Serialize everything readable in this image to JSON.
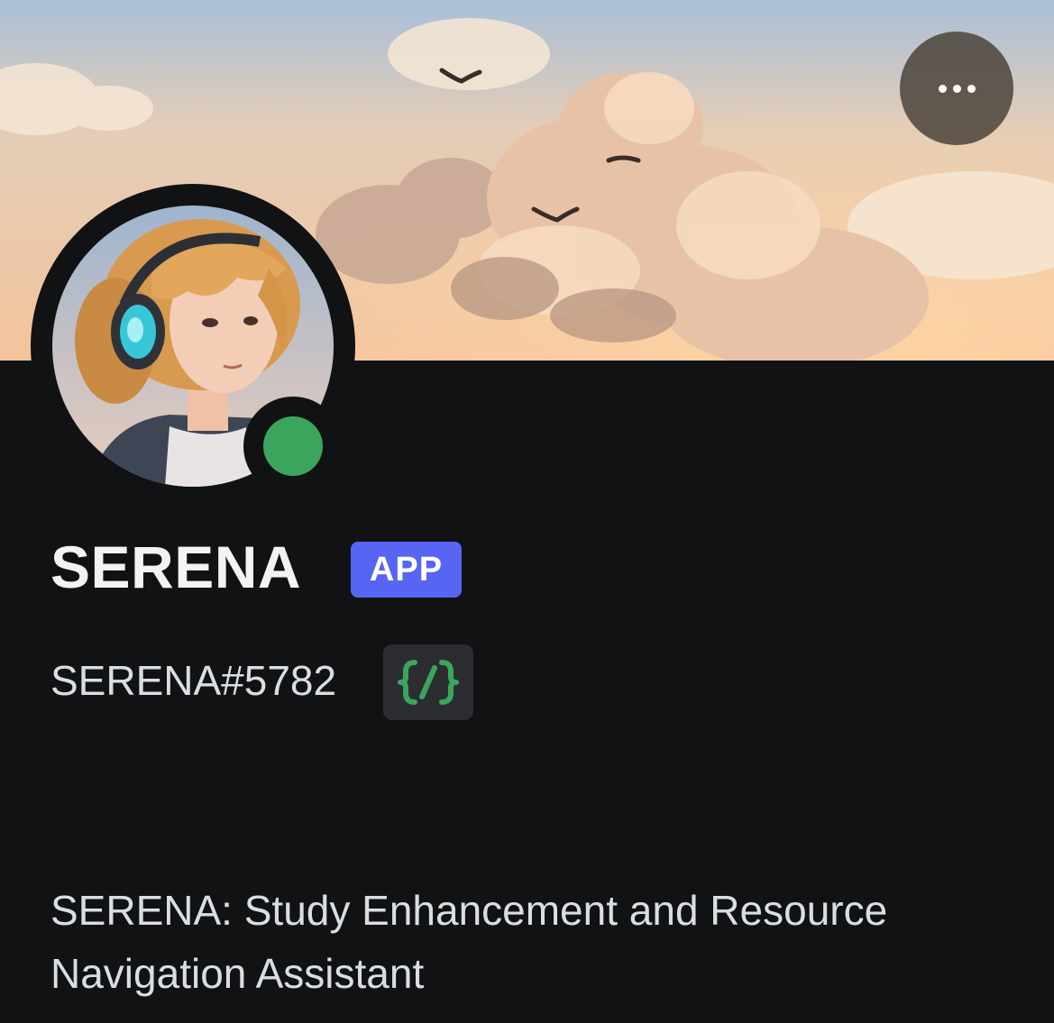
{
  "profile": {
    "display_name": "SERENA",
    "badge_label": "APP",
    "username": "SERENA#5782",
    "bio": "SERENA: Study Enhancement and Resource Navigation Assistant",
    "status": "online"
  },
  "icons": {
    "more": "more-options-icon",
    "slash_commands": "slash-commands-icon",
    "status": "online-status-icon"
  },
  "colors": {
    "background": "#111214",
    "badge": "#5865f2",
    "status_online": "#3ba55d",
    "slash_icon": "#3ba55d"
  }
}
